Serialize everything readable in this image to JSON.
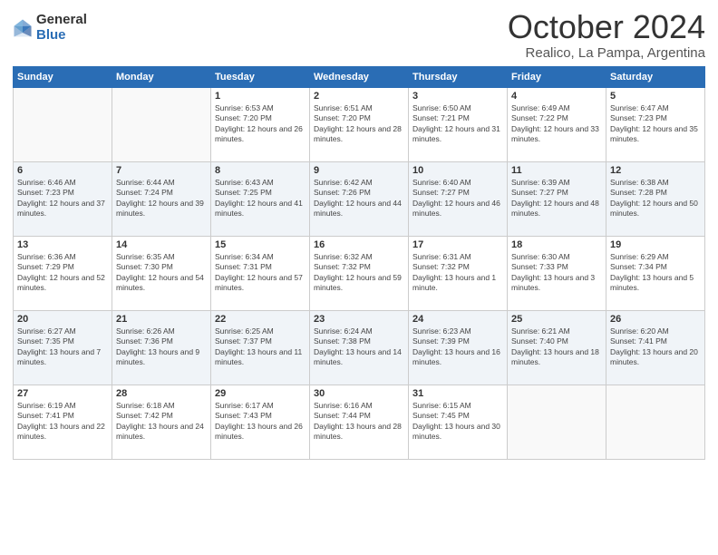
{
  "logo": {
    "general": "General",
    "blue": "Blue"
  },
  "title": "October 2024",
  "location": "Realico, La Pampa, Argentina",
  "weekdays": [
    "Sunday",
    "Monday",
    "Tuesday",
    "Wednesday",
    "Thursday",
    "Friday",
    "Saturday"
  ],
  "weeks": [
    [
      {
        "day": "",
        "sunrise": "",
        "sunset": "",
        "daylight": ""
      },
      {
        "day": "",
        "sunrise": "",
        "sunset": "",
        "daylight": ""
      },
      {
        "day": "1",
        "sunrise": "Sunrise: 6:53 AM",
        "sunset": "Sunset: 7:20 PM",
        "daylight": "Daylight: 12 hours and 26 minutes."
      },
      {
        "day": "2",
        "sunrise": "Sunrise: 6:51 AM",
        "sunset": "Sunset: 7:20 PM",
        "daylight": "Daylight: 12 hours and 28 minutes."
      },
      {
        "day": "3",
        "sunrise": "Sunrise: 6:50 AM",
        "sunset": "Sunset: 7:21 PM",
        "daylight": "Daylight: 12 hours and 31 minutes."
      },
      {
        "day": "4",
        "sunrise": "Sunrise: 6:49 AM",
        "sunset": "Sunset: 7:22 PM",
        "daylight": "Daylight: 12 hours and 33 minutes."
      },
      {
        "day": "5",
        "sunrise": "Sunrise: 6:47 AM",
        "sunset": "Sunset: 7:23 PM",
        "daylight": "Daylight: 12 hours and 35 minutes."
      }
    ],
    [
      {
        "day": "6",
        "sunrise": "Sunrise: 6:46 AM",
        "sunset": "Sunset: 7:23 PM",
        "daylight": "Daylight: 12 hours and 37 minutes."
      },
      {
        "day": "7",
        "sunrise": "Sunrise: 6:44 AM",
        "sunset": "Sunset: 7:24 PM",
        "daylight": "Daylight: 12 hours and 39 minutes."
      },
      {
        "day": "8",
        "sunrise": "Sunrise: 6:43 AM",
        "sunset": "Sunset: 7:25 PM",
        "daylight": "Daylight: 12 hours and 41 minutes."
      },
      {
        "day": "9",
        "sunrise": "Sunrise: 6:42 AM",
        "sunset": "Sunset: 7:26 PM",
        "daylight": "Daylight: 12 hours and 44 minutes."
      },
      {
        "day": "10",
        "sunrise": "Sunrise: 6:40 AM",
        "sunset": "Sunset: 7:27 PM",
        "daylight": "Daylight: 12 hours and 46 minutes."
      },
      {
        "day": "11",
        "sunrise": "Sunrise: 6:39 AM",
        "sunset": "Sunset: 7:27 PM",
        "daylight": "Daylight: 12 hours and 48 minutes."
      },
      {
        "day": "12",
        "sunrise": "Sunrise: 6:38 AM",
        "sunset": "Sunset: 7:28 PM",
        "daylight": "Daylight: 12 hours and 50 minutes."
      }
    ],
    [
      {
        "day": "13",
        "sunrise": "Sunrise: 6:36 AM",
        "sunset": "Sunset: 7:29 PM",
        "daylight": "Daylight: 12 hours and 52 minutes."
      },
      {
        "day": "14",
        "sunrise": "Sunrise: 6:35 AM",
        "sunset": "Sunset: 7:30 PM",
        "daylight": "Daylight: 12 hours and 54 minutes."
      },
      {
        "day": "15",
        "sunrise": "Sunrise: 6:34 AM",
        "sunset": "Sunset: 7:31 PM",
        "daylight": "Daylight: 12 hours and 57 minutes."
      },
      {
        "day": "16",
        "sunrise": "Sunrise: 6:32 AM",
        "sunset": "Sunset: 7:32 PM",
        "daylight": "Daylight: 12 hours and 59 minutes."
      },
      {
        "day": "17",
        "sunrise": "Sunrise: 6:31 AM",
        "sunset": "Sunset: 7:32 PM",
        "daylight": "Daylight: 13 hours and 1 minute."
      },
      {
        "day": "18",
        "sunrise": "Sunrise: 6:30 AM",
        "sunset": "Sunset: 7:33 PM",
        "daylight": "Daylight: 13 hours and 3 minutes."
      },
      {
        "day": "19",
        "sunrise": "Sunrise: 6:29 AM",
        "sunset": "Sunset: 7:34 PM",
        "daylight": "Daylight: 13 hours and 5 minutes."
      }
    ],
    [
      {
        "day": "20",
        "sunrise": "Sunrise: 6:27 AM",
        "sunset": "Sunset: 7:35 PM",
        "daylight": "Daylight: 13 hours and 7 minutes."
      },
      {
        "day": "21",
        "sunrise": "Sunrise: 6:26 AM",
        "sunset": "Sunset: 7:36 PM",
        "daylight": "Daylight: 13 hours and 9 minutes."
      },
      {
        "day": "22",
        "sunrise": "Sunrise: 6:25 AM",
        "sunset": "Sunset: 7:37 PM",
        "daylight": "Daylight: 13 hours and 11 minutes."
      },
      {
        "day": "23",
        "sunrise": "Sunrise: 6:24 AM",
        "sunset": "Sunset: 7:38 PM",
        "daylight": "Daylight: 13 hours and 14 minutes."
      },
      {
        "day": "24",
        "sunrise": "Sunrise: 6:23 AM",
        "sunset": "Sunset: 7:39 PM",
        "daylight": "Daylight: 13 hours and 16 minutes."
      },
      {
        "day": "25",
        "sunrise": "Sunrise: 6:21 AM",
        "sunset": "Sunset: 7:40 PM",
        "daylight": "Daylight: 13 hours and 18 minutes."
      },
      {
        "day": "26",
        "sunrise": "Sunrise: 6:20 AM",
        "sunset": "Sunset: 7:41 PM",
        "daylight": "Daylight: 13 hours and 20 minutes."
      }
    ],
    [
      {
        "day": "27",
        "sunrise": "Sunrise: 6:19 AM",
        "sunset": "Sunset: 7:41 PM",
        "daylight": "Daylight: 13 hours and 22 minutes."
      },
      {
        "day": "28",
        "sunrise": "Sunrise: 6:18 AM",
        "sunset": "Sunset: 7:42 PM",
        "daylight": "Daylight: 13 hours and 24 minutes."
      },
      {
        "day": "29",
        "sunrise": "Sunrise: 6:17 AM",
        "sunset": "Sunset: 7:43 PM",
        "daylight": "Daylight: 13 hours and 26 minutes."
      },
      {
        "day": "30",
        "sunrise": "Sunrise: 6:16 AM",
        "sunset": "Sunset: 7:44 PM",
        "daylight": "Daylight: 13 hours and 28 minutes."
      },
      {
        "day": "31",
        "sunrise": "Sunrise: 6:15 AM",
        "sunset": "Sunset: 7:45 PM",
        "daylight": "Daylight: 13 hours and 30 minutes."
      },
      {
        "day": "",
        "sunrise": "",
        "sunset": "",
        "daylight": ""
      },
      {
        "day": "",
        "sunrise": "",
        "sunset": "",
        "daylight": ""
      }
    ]
  ]
}
